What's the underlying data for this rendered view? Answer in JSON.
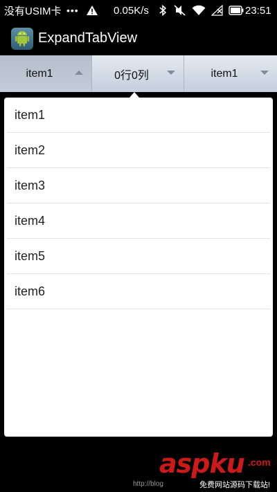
{
  "status_bar": {
    "carrier": "没有USIM卡",
    "dots": "•••",
    "speed": "0.05K/s",
    "time": "23:51",
    "icons": [
      "warning-icon",
      "bluetooth-icon",
      "mute-icon",
      "wifi-icon",
      "no-signal-icon",
      "battery-icon"
    ]
  },
  "action_bar": {
    "title": "ExpandTabView",
    "icon": "android-app-icon"
  },
  "tabs": [
    {
      "label": "item1",
      "arrow": "up",
      "active": true
    },
    {
      "label": "0行0列",
      "arrow": "down",
      "active": false
    },
    {
      "label": "item1",
      "arrow": "down",
      "active": false
    }
  ],
  "dropdown": {
    "items": [
      "item1",
      "item2",
      "item3",
      "item4",
      "item5",
      "item6"
    ]
  },
  "watermark": {
    "logo": "aspku",
    "tld": ".com",
    "subtitle": "免费网站源码下载站!",
    "url": "http://blog"
  },
  "colors": {
    "tab_bar_top": "#e4e9f0",
    "tab_bar_bottom": "#c4cfdd",
    "tab_active": "#b5bfcc",
    "watermark_red": "#cc1a1a"
  }
}
